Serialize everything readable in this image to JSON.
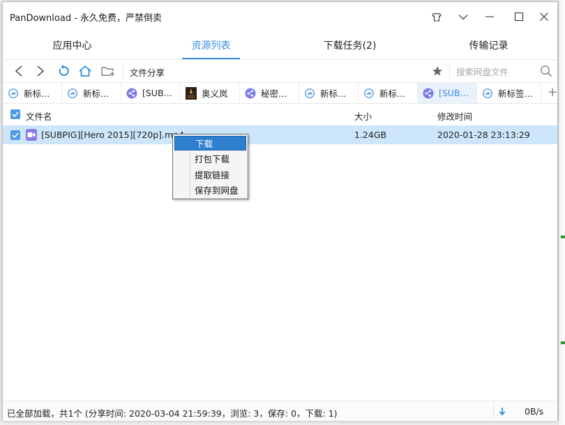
{
  "window": {
    "title": "PanDownload - 永久免费，严禁倒卖"
  },
  "nav_tabs": [
    {
      "label": "应用中心",
      "active": false
    },
    {
      "label": "资源列表",
      "active": true
    },
    {
      "label": "下载任务(2)",
      "active": false
    },
    {
      "label": "传输记录",
      "active": false
    }
  ],
  "toolbar": {
    "path": "文件分享",
    "search_placeholder": "搜索网盘文件"
  },
  "resource_tabs": [
    {
      "label": "新标…",
      "icon": "cloud-icon"
    },
    {
      "label": "新标…",
      "icon": "cloud-icon"
    },
    {
      "label": "[SUB…",
      "icon": "share-icon"
    },
    {
      "label": "奥义岚",
      "icon": "thumbnail-icon"
    },
    {
      "label": "秘密…",
      "icon": "share-icon"
    },
    {
      "label": "新标…",
      "icon": "cloud-icon"
    },
    {
      "label": "新标…",
      "icon": "cloud-icon"
    },
    {
      "label": "[SUB…",
      "icon": "share-icon",
      "active": true
    },
    {
      "label": "新标签…",
      "icon": "cloud-icon"
    }
  ],
  "list": {
    "columns": {
      "name": "文件名",
      "size": "大小",
      "modified": "修改时间"
    },
    "rows": [
      {
        "name": "[SUBPIG][Hero 2015][720p].mp4",
        "size": "1.24GB",
        "modified": "2020-01-28 23:13:29",
        "selected": true
      }
    ]
  },
  "context_menu": {
    "items": [
      {
        "label": "下载",
        "highlighted": true
      },
      {
        "label": "打包下载"
      },
      {
        "label": "提取链接"
      },
      {
        "label": "保存到网盘"
      }
    ]
  },
  "status": {
    "text": "已全部加载，共1个 (分享时间: 2020-03-04 21:59:39，浏览: 3，保存: 0，下载: 1)",
    "speed": "0B/s"
  },
  "colors": {
    "accent": "#3a8fe0",
    "selection": "#cde6fb",
    "menu_highlight": "#2f7fd0"
  }
}
